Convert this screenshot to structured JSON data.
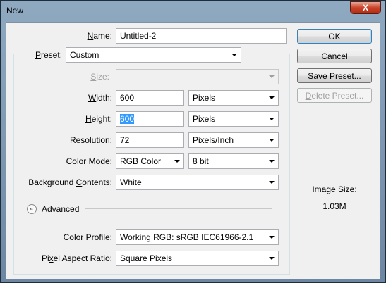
{
  "window": {
    "title": "New",
    "close_glyph": "X"
  },
  "name": {
    "label_u": "N",
    "label_rest": "ame:",
    "value": "Untitled-2"
  },
  "preset": {
    "label_u": "P",
    "label_rest": "reset:",
    "value": "Custom"
  },
  "size": {
    "label_u": "S",
    "label_rest": "ize:",
    "value": ""
  },
  "width": {
    "label_u": "W",
    "label_rest": "idth:",
    "value": "600",
    "unit": "Pixels"
  },
  "height": {
    "label_u": "H",
    "label_rest": "eight:",
    "value": "600",
    "unit": "Pixels"
  },
  "resolution": {
    "label_u": "R",
    "label_rest": "esolution:",
    "value": "72",
    "unit": "Pixels/Inch"
  },
  "color_mode": {
    "label_pre": "Color ",
    "label_u": "M",
    "label_rest": "ode:",
    "value": "RGB Color",
    "depth": "8 bit"
  },
  "background": {
    "label_pre": "Background ",
    "label_u": "C",
    "label_rest": "ontents:",
    "value": "White"
  },
  "advanced": {
    "label": "Advanced",
    "toggle_glyph": "«"
  },
  "color_profile": {
    "label_pre": "Color Pr",
    "label_u": "o",
    "label_rest": "file:",
    "value": "Working RGB:  sRGB IEC61966-2.1"
  },
  "pixel_aspect": {
    "label_pre": "Pi",
    "label_u": "x",
    "label_rest": "el Aspect Ratio:",
    "value": "Square Pixels"
  },
  "buttons": {
    "ok": "OK",
    "cancel": "Cancel",
    "save_u": "S",
    "save_rest": "ave Preset...",
    "delete_u": "D",
    "delete_rest": "elete Preset..."
  },
  "image_size": {
    "label": "Image Size:",
    "value": "1.03M"
  },
  "colors": {
    "title_bar": "#7f99b4",
    "selection": "#3399ff",
    "default_button_border": "#3c7fb1"
  }
}
